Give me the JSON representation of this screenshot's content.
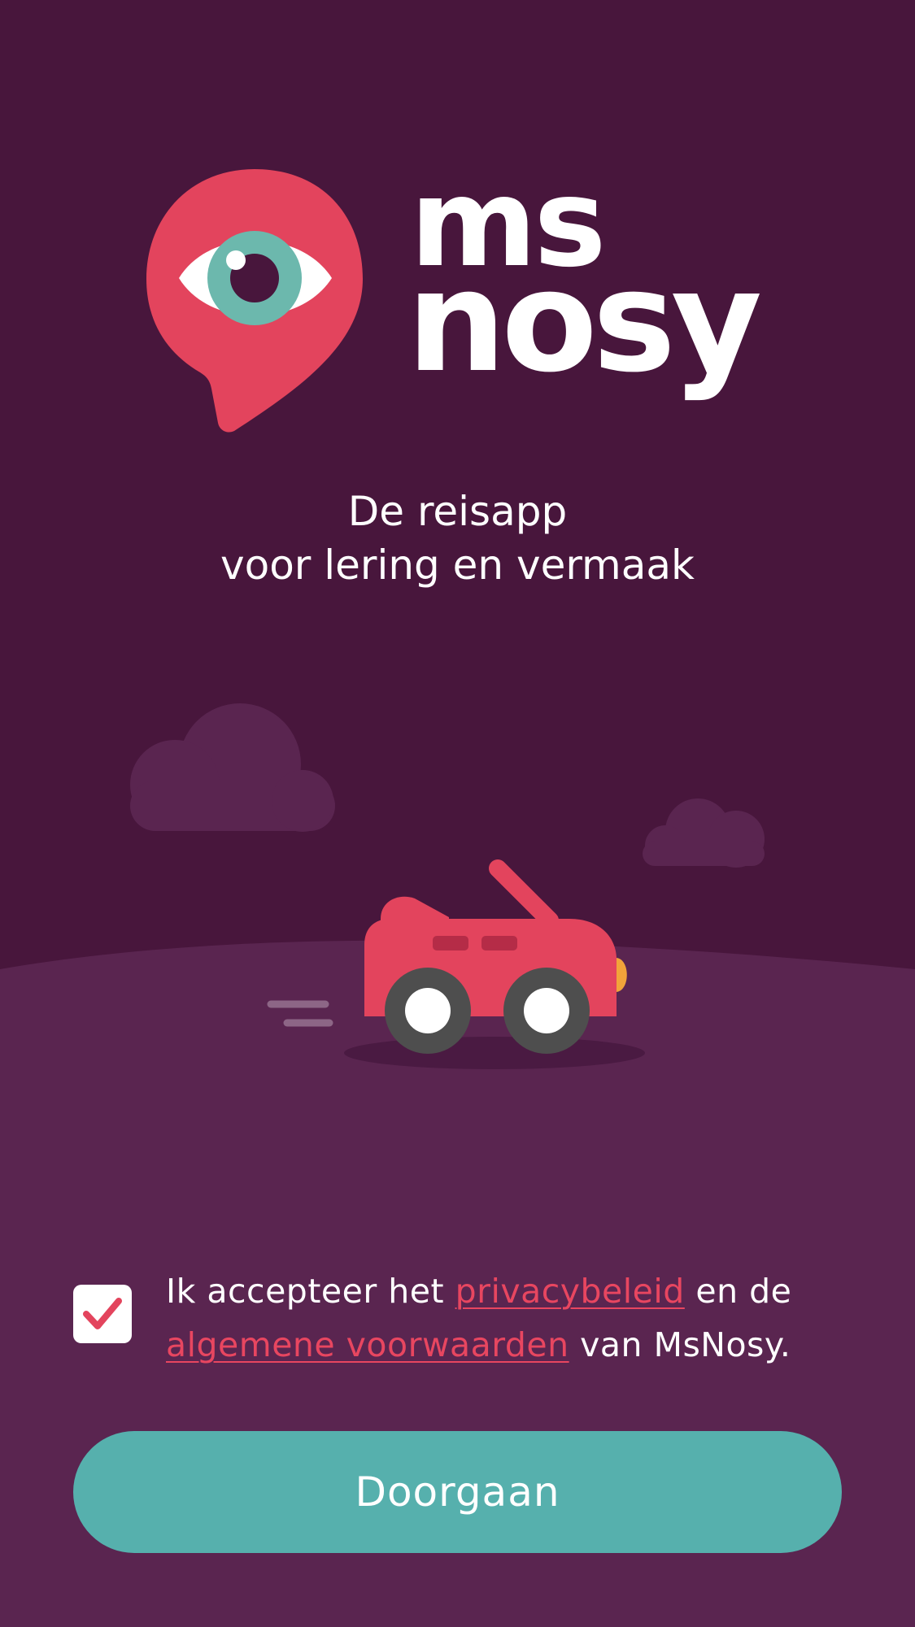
{
  "brand": {
    "name_line1": "ms",
    "name_line2": "nosy",
    "logo_color": "#e3445d",
    "eye_color": "#6cb8ad"
  },
  "tagline": {
    "line1": "De reisapp",
    "line2": "voor lering en vermaak"
  },
  "consent": {
    "checked": true,
    "text_before": "Ik accepteer het ",
    "privacy_link": "privacybeleid",
    "text_middle": " en de ",
    "terms_link": "algemene voorwaarden",
    "text_after": " van MsNosy."
  },
  "actions": {
    "continue_label": "Doorgaan"
  },
  "colors": {
    "background": "#48163c",
    "ground": "#5a2550",
    "accent": "#e84660",
    "button": "#56b0ad"
  }
}
